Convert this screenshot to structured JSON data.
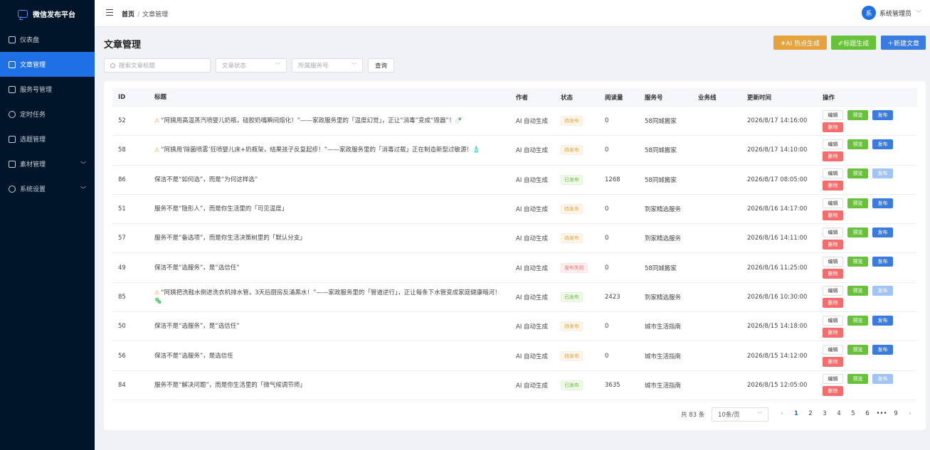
{
  "sidebar": {
    "brand": "微信发布平台",
    "items": [
      {
        "label": "仪表盘",
        "icon": "monitor-icon",
        "active": false
      },
      {
        "label": "文章管理",
        "icon": "document-icon",
        "active": true
      },
      {
        "label": "服务号管理",
        "icon": "chat-icon",
        "active": false
      },
      {
        "label": "定时任务",
        "icon": "timer-icon",
        "active": false
      },
      {
        "label": "选题管理",
        "icon": "notebook-icon",
        "active": false
      },
      {
        "label": "素材管理",
        "icon": "briefcase-icon",
        "active": false,
        "expandable": true
      },
      {
        "label": "系统设置",
        "icon": "gear-icon",
        "active": false,
        "expandable": true
      }
    ]
  },
  "header": {
    "breadcrumb_home": "首页",
    "breadcrumb_sep": "/",
    "breadcrumb_current": "文章管理",
    "avatar_text": "系",
    "user_name": "系统管理员"
  },
  "page": {
    "title": "文章管理",
    "btn_ai": "✈AI 热点生成",
    "btn_gen": "✐标题生成",
    "btn_new": "＋新建文章"
  },
  "filters": {
    "search_placeholder": "搜索文章标题",
    "status_placeholder": "文章状态",
    "service_placeholder": "所属服务号",
    "query_label": "查询"
  },
  "table": {
    "headers": [
      "ID",
      "标题",
      "作者",
      "状态",
      "阅读量",
      "服务号",
      "业务线",
      "更新时间",
      "操作"
    ],
    "op_labels": {
      "edit": "编辑",
      "preview": "预览",
      "publish": "发布",
      "delete": "删除"
    },
    "rows": [
      {
        "id": "52",
        "warn": true,
        "title": "“阿姨用高温蒸汽喷婴儿奶瓶，硅胶奶嘴瞬间熔化！”——家政服务里的「温度幻觉」，正让“消毒”变成“毁器”！🍼",
        "author": "AI 自动生成",
        "status": "待发布",
        "status_type": "pending",
        "reads": "0",
        "service": "58同城搬家",
        "biz": "",
        "time": "2026/8/17 14:16:00",
        "publish_disabled": false
      },
      {
        "id": "58",
        "warn": true,
        "title": "“阿姨用‘除菌喷雾’狂喷婴儿床+奶瓶架，结果孩子反复起疹！”——家政服务里的「消毒过载」正在制造新型过敏源！🧴",
        "author": "AI 自动生成",
        "status": "待发布",
        "status_type": "pending",
        "reads": "0",
        "service": "58同城搬家",
        "biz": "",
        "time": "2026/8/17 14:10:00",
        "publish_disabled": false
      },
      {
        "id": "86",
        "warn": false,
        "title": "保洁不是“如何选”，而是“为何这样选”",
        "author": "AI 自动生成",
        "status": "已发布",
        "status_type": "published",
        "reads": "1268",
        "service": "58同城搬家",
        "biz": "",
        "time": "2026/8/17 08:05:00",
        "publish_disabled": true
      },
      {
        "id": "51",
        "warn": false,
        "title": "服务不是“隐形人”，而是你生活里的「可见温度」",
        "author": "AI 自动生成",
        "status": "待发布",
        "status_type": "pending",
        "reads": "0",
        "service": "到家精选服务",
        "biz": "",
        "time": "2026/8/16 14:17:00",
        "publish_disabled": false
      },
      {
        "id": "57",
        "warn": false,
        "title": "服务不是“备选项”，而是你生活决策树里的「默认分支」",
        "author": "AI 自动生成",
        "status": "待发布",
        "status_type": "pending",
        "reads": "0",
        "service": "到家精选服务",
        "biz": "",
        "time": "2026/8/16 14:11:00",
        "publish_disabled": false
      },
      {
        "id": "49",
        "warn": false,
        "title": "保洁不是“选服务”，是“选信任”",
        "author": "AI 自动生成",
        "status": "发布失败",
        "status_type": "failed",
        "reads": "0",
        "service": "58同城搬家",
        "biz": "",
        "time": "2026/8/16 11:25:00",
        "publish_disabled": false
      },
      {
        "id": "85",
        "warn": true,
        "title": "“阿姨把洗鞋水倒进洗衣机排水管，3天后厨房反涌黑水！”——家政服务里的「管道逆行」，正让每条下水管变成家庭健康暗河！🦠",
        "author": "AI 自动生成",
        "status": "已发布",
        "status_type": "published",
        "reads": "2423",
        "service": "到家精选服务",
        "biz": "",
        "time": "2026/8/16 10:30:00",
        "publish_disabled": true
      },
      {
        "id": "50",
        "warn": false,
        "title": "保洁不是“选服务”，是“选信任”",
        "author": "AI 自动生成",
        "status": "待发布",
        "status_type": "pending",
        "reads": "0",
        "service": "城市生活指南",
        "biz": "",
        "time": "2026/8/15 14:18:00",
        "publish_disabled": false
      },
      {
        "id": "56",
        "warn": false,
        "title": "保洁不是“选服务”，是选信任",
        "author": "AI 自动生成",
        "status": "待发布",
        "status_type": "pending",
        "reads": "0",
        "service": "城市生活指南",
        "biz": "",
        "time": "2026/8/15 14:12:00",
        "publish_disabled": false
      },
      {
        "id": "84",
        "warn": false,
        "title": "服务不是“解决问题”，而是你生活里的「微气候调节师」",
        "author": "AI 自动生成",
        "status": "已发布",
        "status_type": "published",
        "reads": "3635",
        "service": "城市生活指南",
        "biz": "",
        "time": "2026/8/15 12:05:00",
        "publish_disabled": true
      }
    ]
  },
  "pagination": {
    "total": "共 83 条",
    "page_size": "10条/页",
    "prev": "‹",
    "next": "›",
    "pages": [
      "1",
      "2",
      "3",
      "4",
      "5",
      "6",
      "•••",
      "9"
    ],
    "current": "1"
  },
  "colors": {
    "sidebar_bg": "#001529",
    "primary": "#1f6fe5",
    "warning": "#e6a23c",
    "success": "#67c23a",
    "danger": "#f56c6c"
  }
}
